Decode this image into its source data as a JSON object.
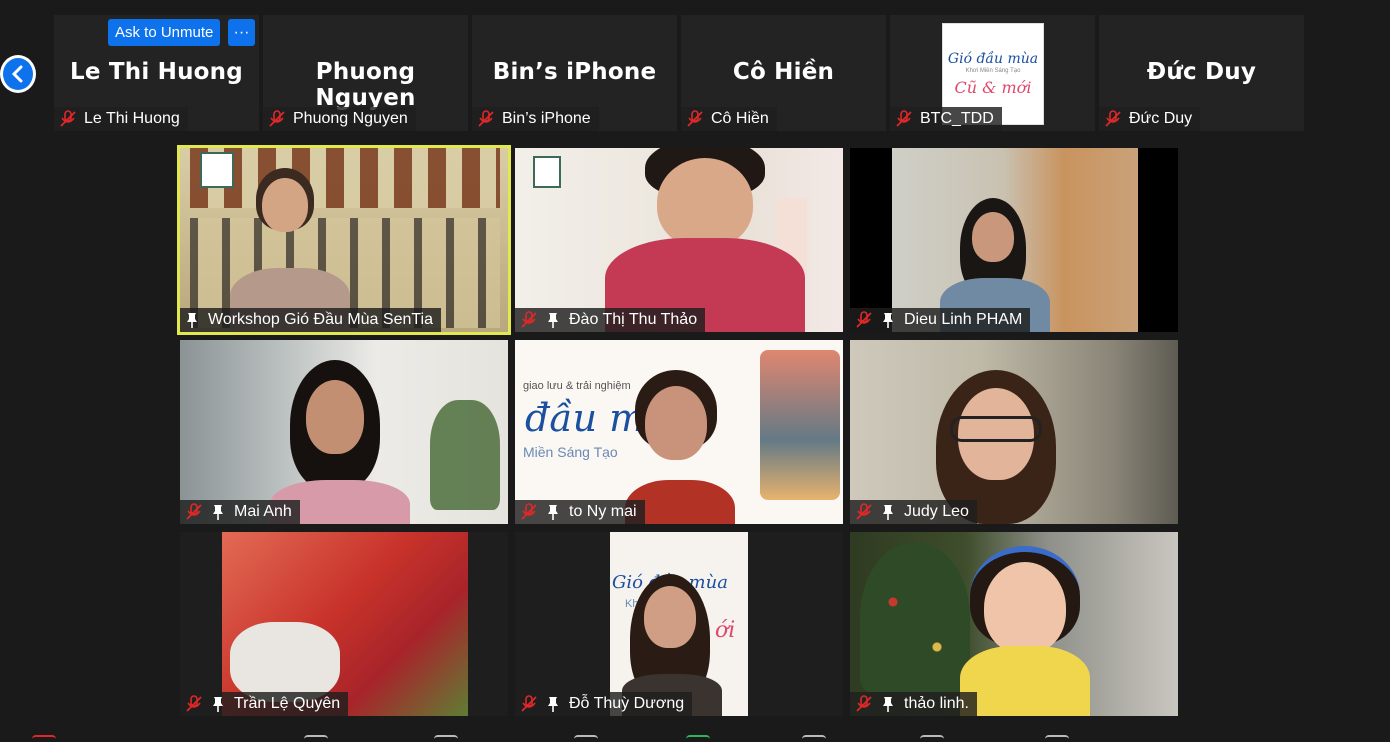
{
  "top_strip": {
    "ask_to_unmute_label": "Ask to Unmute",
    "more_label": "···",
    "tiles": [
      {
        "display": "Le Thi Huong",
        "label": "Le Thi Huong"
      },
      {
        "display": "Phuong Nguyen",
        "label": "Phuong Nguyen"
      },
      {
        "display": "Bin’s iPhone",
        "label": "Bin’s iPhone"
      },
      {
        "display": "Cô Hiền",
        "label": "Cô Hiền"
      },
      {
        "display": "",
        "label": "BTC_TDD"
      },
      {
        "display": "Đức Duy",
        "label": "Đức Duy"
      }
    ],
    "logo": {
      "line1": "Gió đầu mùa",
      "line2": "Khơi Miền Sáng Tạo",
      "line3": "Cũ & mới"
    }
  },
  "grid": [
    {
      "label": "Workshop Gió Đầu Mùa SenTia",
      "muted": false,
      "pinned": true,
      "active": true
    },
    {
      "label": "Đào Thị Thu Thảo",
      "muted": true,
      "pinned": true,
      "active": false
    },
    {
      "label": "Dieu Linh PHAM",
      "muted": true,
      "pinned": true,
      "active": false
    },
    {
      "label": "Mai Anh",
      "muted": true,
      "pinned": true,
      "active": false
    },
    {
      "label": "to Ny mai",
      "muted": true,
      "pinned": true,
      "active": false
    },
    {
      "label": "Judy Leo",
      "muted": true,
      "pinned": true,
      "active": false
    },
    {
      "label": "Trần Lệ Quyên",
      "muted": true,
      "pinned": true,
      "active": false
    },
    {
      "label": "Đỗ Thuỳ Dương",
      "muted": true,
      "pinned": true,
      "active": false
    },
    {
      "label": "thảo linh.",
      "muted": true,
      "pinned": true,
      "active": false
    }
  ],
  "tile_backdrops": {
    "t5_line1": "giao lưu & trải nghiệm",
    "t5_line2": "đầu mù",
    "t5_line3": "Miền Sáng Tạo",
    "t8_line1": "Gió đầu mùa",
    "t8_line2": "Khơi   Tạo",
    "t8_line3": "ới"
  },
  "colors": {
    "accent": "#0e72ed",
    "active_speaker": "#e2e84f",
    "mute_red": "#e02828",
    "background": "#1a1a1a"
  },
  "icons": {
    "nav": "chevron-left-icon",
    "muted": "mic-muted-icon",
    "pin": "pin-icon"
  }
}
